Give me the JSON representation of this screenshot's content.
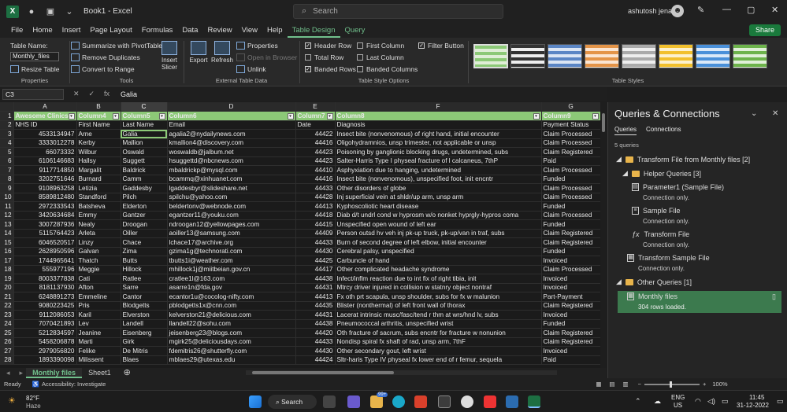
{
  "window": {
    "title": "Book1 - Excel",
    "search_placeholder": "Search",
    "user": "ashutosh jena"
  },
  "ribbon_tabs": [
    "File",
    "Home",
    "Insert",
    "Page Layout",
    "Formulas",
    "Data",
    "Review",
    "View",
    "Help",
    "Table Design",
    "Query"
  ],
  "share_label": "Share",
  "ribbon": {
    "properties": {
      "table_name_label": "Table Name:",
      "table_name_value": "Monthly_files",
      "resize": "Resize Table",
      "group": "Properties"
    },
    "tools": {
      "summarize": "Summarize with PivotTable",
      "remove_dup": "Remove Duplicates",
      "convert": "Convert to Range",
      "insert_slicer": "Insert Slicer",
      "group": "Tools"
    },
    "external": {
      "export": "Export",
      "refresh": "Refresh",
      "properties": "Properties",
      "open_browser": "Open in Browser",
      "unlink": "Unlink",
      "group": "External Table Data"
    },
    "style_options": {
      "header_row": "Header Row",
      "total_row": "Total Row",
      "banded_rows": "Banded Rows",
      "first_column": "First Column",
      "last_column": "Last Column",
      "banded_columns": "Banded Columns",
      "filter_button": "Filter Button",
      "group": "Table Style Options"
    },
    "styles_group": "Table Styles"
  },
  "formula_bar": {
    "name_box": "C3",
    "fx": "fx",
    "value": "Galia"
  },
  "columns": [
    "A",
    "B",
    "C",
    "D",
    "E",
    "F",
    "G"
  ],
  "table_header": [
    "Awesome Clinics",
    "Column4",
    "Column5",
    "Column6",
    "Column7",
    "Column8",
    "Column9"
  ],
  "rows": [
    [
      "NHS ID",
      "First Name",
      "Last Name",
      "Email",
      "Date",
      "Diagnosis",
      "Payment Status"
    ],
    [
      "4533134947",
      "Arne",
      "Galia",
      "agalia2@nydailynews.com",
      "44422",
      "Insect bite (nonvenomous) of right hand, initial encounter",
      "Claim Processed"
    ],
    [
      "3333012278",
      "Kerby",
      "Mallion",
      "kmallion4@discovery.com",
      "44416",
      "Oligohydramnios, unsp trimester, not applicable or unsp",
      "Claim Processed"
    ],
    [
      "66073332",
      "Wilbur",
      "Oswald",
      "woswaldb@jalbum.net",
      "44423",
      "Poisoning by ganglionic blocking drugs, undetermined, subs",
      "Claim Registered"
    ],
    [
      "6106146683",
      "Hallsy",
      "Suggett",
      "hsuggettd@nbcnews.com",
      "44423",
      "Salter-Harris Type I physeal fracture of l calcaneus, 7thP",
      "Paid"
    ],
    [
      "9117714850",
      "Margalit",
      "Baldrick",
      "mbaldrickp@mysql.com",
      "44410",
      "Asphyxiation due to hanging, undetermined",
      "Claim Processed"
    ],
    [
      "3202751646",
      "Burnard",
      "Camm",
      "bcammq@xinhuanet.com",
      "44416",
      "Insect bite (nonvenomous), unspecified foot, init encntr",
      "Funded"
    ],
    [
      "9108963258",
      "Letizia",
      "Gaddesby",
      "lgaddesbyr@slideshare.net",
      "44433",
      "Other disorders of globe",
      "Claim Processed"
    ],
    [
      "8589812480",
      "Standford",
      "Pilch",
      "spilchu@yahoo.com",
      "44428",
      "Inj superficial vein at shldr/up arm, unsp arm",
      "Claim Processed"
    ],
    [
      "2972333543",
      "Batsheva",
      "Elderton",
      "beldertonv@webnode.com",
      "44413",
      "Kyphoscoliotic heart disease",
      "Funded"
    ],
    [
      "3420634684",
      "Emmy",
      "Gantzer",
      "egantzer11@youku.com",
      "44418",
      "Diab d/t undrl cond w hyprosm w/o nonket hyprgly-hypros coma",
      "Claim Processed"
    ],
    [
      "3007287936",
      "Nealy",
      "Droogan",
      "ndroogan12@yellowpages.com",
      "44415",
      "Unspecified open wound of left ear",
      "Funded"
    ],
    [
      "5115764423",
      "Arleta",
      "Oiller",
      "aoiller13@samsung.com",
      "44409",
      "Person outsd hv veh inj pk-up truck, pk-up/van in traf, subs",
      "Claim Registered"
    ],
    [
      "6046520517",
      "Linzy",
      "Chace",
      "lchace17@archive.org",
      "44433",
      "Burn of second degree of left elbow, initial encounter",
      "Claim Registered"
    ],
    [
      "2628950596",
      "Galvan",
      "Zima",
      "gzima1g@technorati.com",
      "44430",
      "Cerebral palsy, unspecified",
      "Funded"
    ],
    [
      "1744965641",
      "Thatch",
      "Butts",
      "tbutts1i@weather.com",
      "44425",
      "Carbuncle of hand",
      "Invoiced"
    ],
    [
      "555977196",
      "Meggie",
      "Hillock",
      "mhillock1j@miitbeian.gov.cn",
      "44417",
      "Other complicated headache syndrome",
      "Claim Processed"
    ],
    [
      "8003377838",
      "Cati",
      "Ratlee",
      "cratlee1l@163.com",
      "44438",
      "Infect/inflm reaction due to int fix of right tibia, init",
      "Invoiced"
    ],
    [
      "8181137930",
      "Afton",
      "Sarre",
      "asarre1n@fda.gov",
      "44431",
      "Mtrcy driver injured in collision w statnry object nontraf",
      "Invoiced"
    ],
    [
      "6248891273",
      "Emmeline",
      "Cantor",
      "ecantor1u@cocolog-nifty.com",
      "44413",
      "Fx oth prt scapula, unsp shoulder, subs for fx w malunion",
      "Part-Payment"
    ],
    [
      "9080223425",
      "Pris",
      "Blodgetts",
      "pblodgetts1x@cnn.com",
      "44435",
      "Blister (nonthermal) of left front wall of thorax",
      "Claim Registered"
    ],
    [
      "9112086053",
      "Karil",
      "Elverston",
      "kelverston21@delicious.com",
      "44431",
      "Lacerat intrinsic musc/fasc/tend r thm at wrs/hnd lv, subs",
      "Invoiced"
    ],
    [
      "7070421893",
      "Lev",
      "Landell",
      "llandell22@sohu.com",
      "44438",
      "Pneumococcal arthritis, unspecified wrist",
      "Funded"
    ],
    [
      "5212834597",
      "Jeanine",
      "Eisenberg",
      "jeisenberg23@blogs.com",
      "44420",
      "Oth fracture of sacrum, subs encntr for fracture w nonunion",
      "Claim Registered"
    ],
    [
      "5458206878",
      "Marti",
      "Girk",
      "mgirk25@deliciousdays.com",
      "44433",
      "Nondisp spiral fx shaft of rad, unsp arm, 7thF",
      "Claim Registered"
    ],
    [
      "2979056820",
      "Felike",
      "De Mitris",
      "fdemitris26@shutterfly.com",
      "44430",
      "Other secondary gout, left wrist",
      "Invoiced"
    ],
    [
      "1893390098",
      "Milissent",
      "Blaes",
      "mblaes29@utexas.edu",
      "44424",
      "Sltr-haris Type IV physeal fx lower end of r femur, sequela",
      "Paid"
    ]
  ],
  "sheet_tabs": [
    "Monthly files",
    "Sheet1"
  ],
  "status": {
    "ready": "Ready",
    "accessibility": "Accessibility: Investigate",
    "zoom": "100%"
  },
  "queries": {
    "title": "Queries & Connections",
    "tabs": [
      "Queries",
      "Connections"
    ],
    "count": "5 queries",
    "items": {
      "group1": "Transform File from Monthly files [2]",
      "helper": "Helper Queries [3]",
      "param": "Parameter1 (Sample File)",
      "sample": "Sample File",
      "transform": "Transform File",
      "transform_sample": "Transform Sample File",
      "other": "Other Queries [1]",
      "monthly": "Monthly files",
      "conn_only": "Connection only.",
      "rows_loaded": "304 rows loaded."
    }
  },
  "taskbar": {
    "weather_temp": "82°F",
    "weather_desc": "Haze",
    "search": "Search",
    "lang1": "ENG",
    "lang2": "US",
    "time": "11:45",
    "date": "31-12-2022",
    "badge": "99+"
  }
}
